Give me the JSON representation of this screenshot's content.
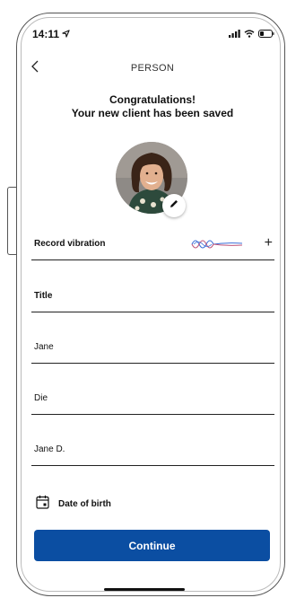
{
  "status_bar": {
    "time": "14:11"
  },
  "nav": {
    "title": "PERSON"
  },
  "message": {
    "line1": "Congratulations!",
    "line2": "Your new client has been saved"
  },
  "form": {
    "record_vibration_label": "Record vibration",
    "title_label": "Title",
    "first_name_value": "Jane",
    "last_name_value": "Die",
    "display_name_value": "Jane D.",
    "date_of_birth_label": "Date of birth"
  },
  "actions": {
    "continue_label": "Continue"
  },
  "colors": {
    "primary": "#0b4ea2",
    "wave_blue": "#3b6fd8",
    "wave_pink": "#c0567a"
  },
  "icons": [
    "back-chevron-icon",
    "location-arrow-icon",
    "signal-icon",
    "wifi-icon",
    "battery-icon",
    "pencil-icon",
    "waveform-icon",
    "plus-icon",
    "calendar-icon"
  ]
}
